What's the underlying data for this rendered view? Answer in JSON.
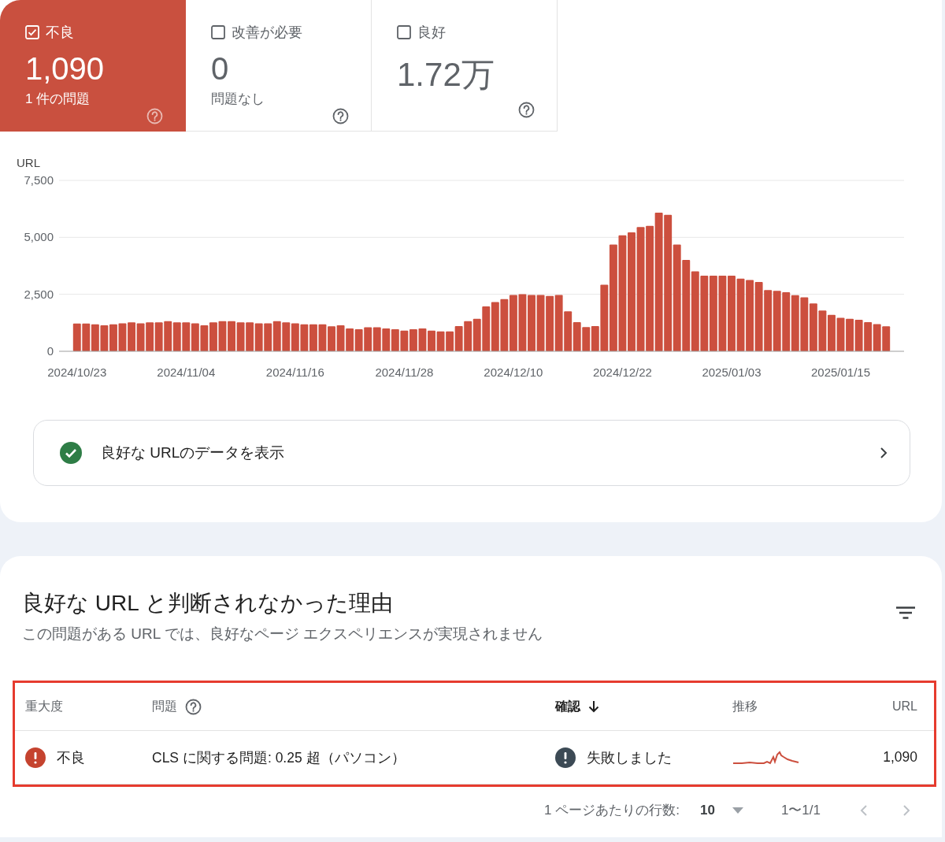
{
  "summary_tiles": [
    {
      "kind": "poor",
      "label": "不良",
      "checked": true,
      "value": "1,090",
      "detail": "1 件の問題"
    },
    {
      "kind": "needs_improvement",
      "label": "改善が必要",
      "checked": false,
      "value": "0",
      "detail": "問題なし"
    },
    {
      "kind": "good",
      "label": "良好",
      "checked": false,
      "value": "1.72万"
    }
  ],
  "chart": {
    "chart_data": {
      "type": "bar",
      "ylabel": "URL",
      "ylim": [
        0,
        7500
      ],
      "yticks": [
        {
          "value": 0,
          "label": "0"
        },
        {
          "value": 2500,
          "label": "2,500"
        },
        {
          "value": 5000,
          "label": "5,000"
        },
        {
          "value": 7500,
          "label": "7,500"
        }
      ],
      "categories": [
        "2024/10/23",
        null,
        null,
        null,
        null,
        null,
        null,
        null,
        null,
        null,
        null,
        null,
        "2024/11/04",
        null,
        null,
        null,
        null,
        null,
        null,
        null,
        null,
        null,
        null,
        null,
        "2024/11/16",
        null,
        null,
        null,
        null,
        null,
        null,
        null,
        null,
        null,
        null,
        null,
        "2024/11/28",
        null,
        null,
        null,
        null,
        null,
        null,
        null,
        null,
        null,
        null,
        null,
        "2024/12/10",
        null,
        null,
        null,
        null,
        null,
        null,
        null,
        null,
        null,
        null,
        null,
        "2024/12/22",
        null,
        null,
        null,
        null,
        null,
        null,
        null,
        null,
        null,
        null,
        null,
        "2025/01/03",
        null,
        null,
        null,
        null,
        null,
        null,
        null,
        null,
        null,
        null,
        null,
        "2025/01/15",
        null,
        null,
        null,
        null,
        null
      ],
      "series": [
        {
          "color": "#cc4f3e",
          "values": [
            1220,
            1220,
            1180,
            1140,
            1180,
            1230,
            1270,
            1230,
            1270,
            1270,
            1320,
            1270,
            1270,
            1230,
            1140,
            1270,
            1320,
            1320,
            1270,
            1270,
            1230,
            1230,
            1320,
            1270,
            1230,
            1180,
            1180,
            1180,
            1100,
            1140,
            1000,
            970,
            1050,
            1050,
            1000,
            970,
            910,
            970,
            1000,
            910,
            870,
            870,
            1110,
            1320,
            1430,
            1970,
            2160,
            2290,
            2470,
            2510,
            2470,
            2470,
            2430,
            2470,
            1750,
            1280,
            1060,
            1110,
            2920,
            4680,
            5090,
            5220,
            5450,
            5500,
            6080,
            5990,
            4680,
            4010,
            3510,
            3320,
            3320,
            3320,
            3320,
            3190,
            3130,
            3040,
            2690,
            2650,
            2590,
            2460,
            2370,
            2100,
            1790,
            1600,
            1470,
            1430,
            1380,
            1280,
            1190,
            1100
          ]
        }
      ]
    }
  },
  "good_urls_link": {
    "label": "良好な URLのデータを表示"
  },
  "issues": {
    "title": "良好な URL と判断されなかった理由",
    "subtitle": "この問題がある URL では、良好なページ エクスペリエンスが実現されません",
    "table": {
      "highlighted": true,
      "columns": [
        {
          "label": "重大度",
          "help": false,
          "sorted": false
        },
        {
          "label": "問題",
          "help": true,
          "sorted": false
        },
        {
          "label": "確認",
          "help": false,
          "sorted": true
        },
        {
          "label": "推移",
          "help": false,
          "sorted": false
        },
        {
          "label": "URL",
          "help": false,
          "sorted": false
        }
      ],
      "rows": [
        {
          "severity": "不良",
          "issue": "CLS に関する問題: 0.25 超（パソコン）",
          "validation": "失敗しました",
          "urls": "1,090"
        }
      ]
    },
    "pagination": {
      "rows_per_page_label": "1 ページあたりの行数:",
      "rows_per_page": "10",
      "range": "1〜1/1"
    }
  }
}
